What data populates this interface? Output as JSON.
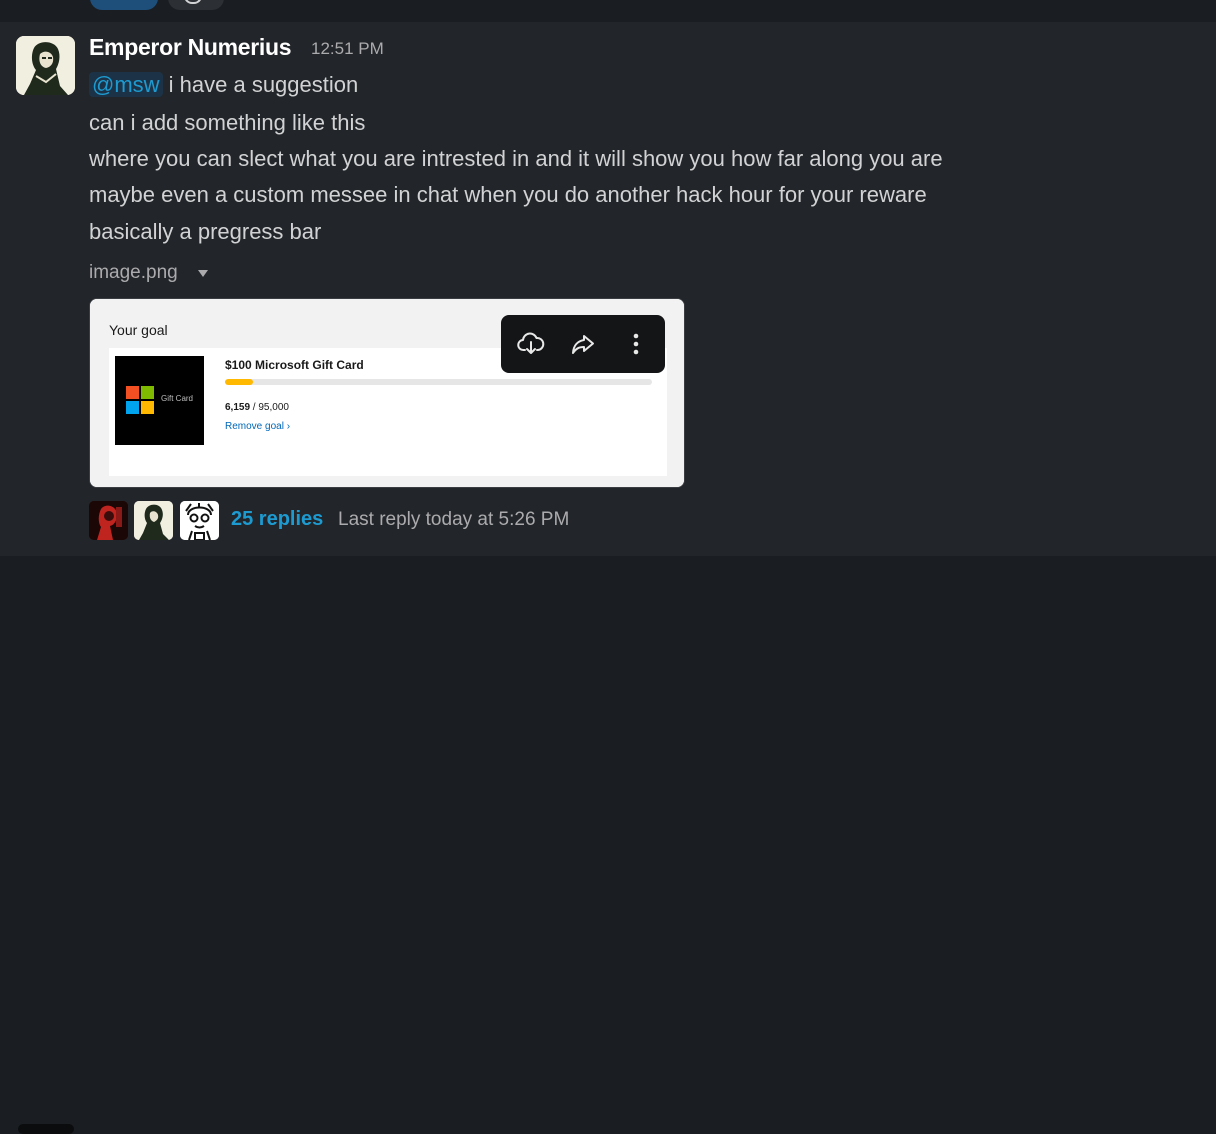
{
  "message": {
    "sender": "Emperor Numerius",
    "time": "12:51 PM",
    "mention": "@msw",
    "lines": [
      " i have a suggestion",
      "can i add something like this",
      "where you can slect what you are intrested in and it will show you how far along you are",
      "maybe even a custom messee in chat when you do another hack hour for your reware",
      "basically a pregress bar"
    ],
    "attachment": {
      "filename": "image.png",
      "preview": {
        "title": "Your goal",
        "card_text": "Gift Card",
        "goal_name": "$100 Microsoft Gift Card",
        "points_current": "6,159",
        "points_total": " / 95,000",
        "progress_fraction": 0.065,
        "remove_label": "Remove goal ›"
      },
      "toolbar": [
        "download-icon",
        "share-icon",
        "more-icon"
      ]
    },
    "thread": {
      "replies": "25 replies",
      "last_reply": "Last reply today at 5:26 PM"
    }
  },
  "colors": {
    "link": "#1d9bd1",
    "progress": "#ffb900",
    "background": "#222529"
  }
}
